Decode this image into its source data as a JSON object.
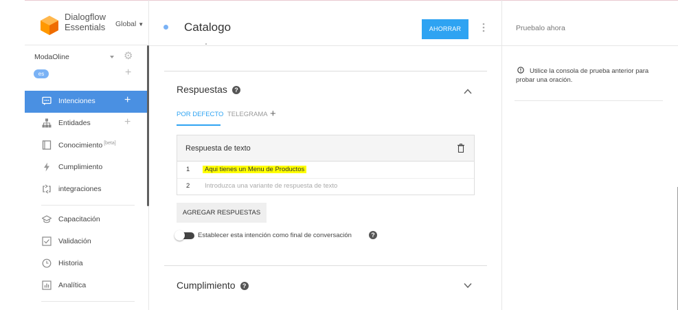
{
  "brand": {
    "name_line1": "Dialogflow",
    "name_line2": "Essentials",
    "region": "Global"
  },
  "agent": {
    "name": "ModaOline",
    "language": "es"
  },
  "sidebar": {
    "items": [
      {
        "label": "Intenciones"
      },
      {
        "label": "Entidades"
      },
      {
        "label": "Conocimiento",
        "badge": "[beta]"
      },
      {
        "label": "Cumplimiento"
      },
      {
        "label": "integraciones"
      },
      {
        "label": "Capacitación"
      },
      {
        "label": "Validación"
      },
      {
        "label": "Historia"
      },
      {
        "label": "Analítica"
      }
    ]
  },
  "intent": {
    "title": "Catalogo",
    "save_label": "AHORRAR"
  },
  "responses": {
    "section_title": "Respuestas",
    "tabs": [
      {
        "label": "POR DEFECTO"
      },
      {
        "label": "TELEGRAMA"
      }
    ],
    "tab_add": "+",
    "box_title": "Respuesta de texto",
    "rows": [
      {
        "num": "1",
        "text": "Aqui tienes un Menu de Productos"
      },
      {
        "num": "2",
        "placeholder": "Introduzca una variante de respuesta de texto"
      }
    ],
    "add_label": "AGREGAR RESPUESTAS",
    "end_conversation_label": "Establecer esta intención como final de conversación",
    "end_conversation_on": false
  },
  "fulfillment": {
    "section_title": "Cumplimiento"
  },
  "try_panel": {
    "title": "Pruebalo ahora",
    "message": "Utilice la consola de prueba anterior para probar una oración."
  },
  "colors": {
    "accent": "#2ea3f2",
    "active_nav": "#4a90e2",
    "highlight": "#ffff00",
    "logo": "#f57c00"
  }
}
